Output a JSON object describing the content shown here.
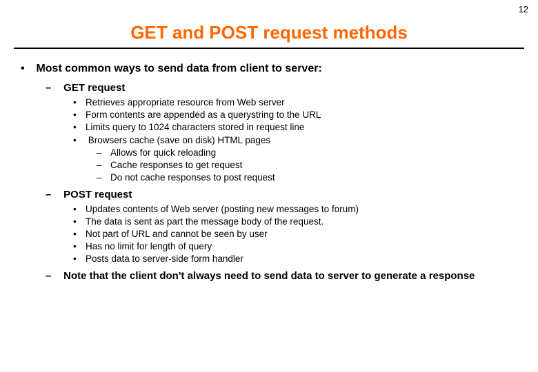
{
  "page_number": "12",
  "title": "GET and POST request methods",
  "main_bullet": "Most common ways to send data from client to server:",
  "get": {
    "heading": "GET request",
    "items": [
      "Retrieves appropriate resource from Web server",
      "Form contents are appended as a querystring to the  URL",
      "Limits query to 1024 characters stored in request line",
      "Browsers cache (save on disk) HTML pages"
    ],
    "sub": [
      "Allows for quick reloading",
      "Cache responses to get request",
      "Do not cache responses to post request"
    ]
  },
  "post": {
    "heading": "POST request",
    "items": [
      "Updates contents of Web server (posting new messages to forum)",
      "The data is sent as part the message body of the request.",
      "Not part of URL and cannot be seen by user",
      "Has no limit for length of query",
      "Posts data to server-side form handler"
    ]
  },
  "note": "Note that the client don't always need to send data to server to generate a response"
}
